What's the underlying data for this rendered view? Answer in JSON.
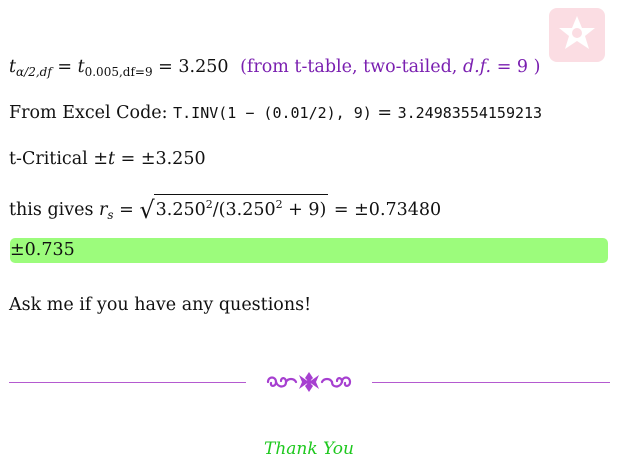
{
  "formula_line": {
    "lhs_var": "t",
    "lhs_sub": "α/2,df",
    "eq1": " = ",
    "mid_var": "t",
    "mid_sub": "0.005,df=9",
    "eq2": " = 3.250",
    "note_open": "(from t-table, two-tailed, ",
    "note_df": "d.f.",
    "note_close": " = 9 )"
  },
  "excel_line": {
    "prefix": "From Excel Code: ",
    "code": "T.INV(1 − (0.01/2), 9)",
    "eq": " = ",
    "result": "3.24983554159213"
  },
  "critical_line": {
    "prefix": "t-Critical ±",
    "var": "t",
    "value": " = ±3.250"
  },
  "rs_line": {
    "prefix": "this gives ",
    "var": "r",
    "var_sub": "s",
    "eq": " = ",
    "radical": "√",
    "num_base": "3.250",
    "num_exp": "2",
    "mid": "/(3.250",
    "den_exp": "2",
    "den_tail": " + 9)",
    "result": " = ±0.73480"
  },
  "answer": "±0.735",
  "closing": "Ask me if you have any questions!",
  "thanks": "Thank You",
  "colors": {
    "purple_note": "#7a1fb0",
    "answer_highlight": "#9cfc7c",
    "thanks_green": "#1ec81e",
    "divider": "#b45ad0",
    "logo_pink": "#fbdde3"
  },
  "icons": [
    "ornament-divider-icon",
    "corner-logo-icon"
  ]
}
